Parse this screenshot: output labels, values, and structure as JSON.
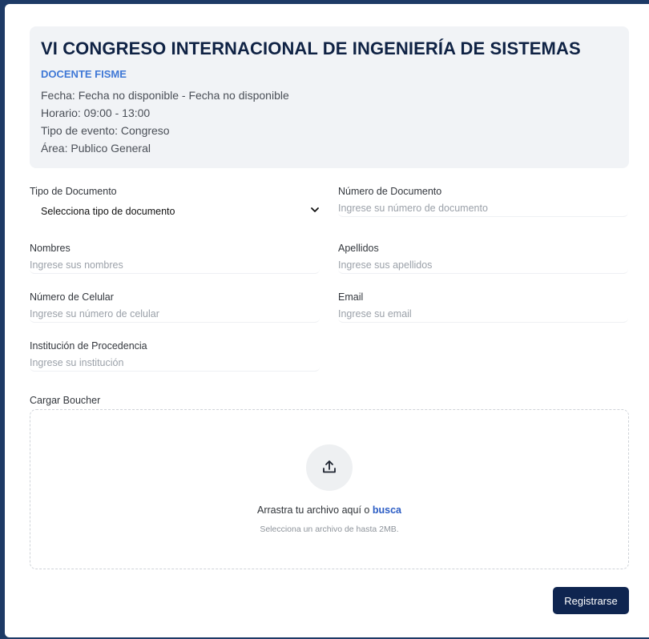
{
  "event": {
    "title": "VI CONGRESO INTERNACIONAL DE INGENIERÍA DE SISTEMAS",
    "subtitle": "DOCENTE FISME",
    "fecha": "Fecha: Fecha no disponible - Fecha no disponible",
    "horario": "Horario: 09:00 - 13:00",
    "tipo_evento": "Tipo de evento: Congreso",
    "area": "Área: Publico General"
  },
  "form": {
    "tipo_documento": {
      "label": "Tipo de Documento",
      "selected": "Selecciona tipo de documento"
    },
    "numero_documento": {
      "label": "Número de Documento",
      "placeholder": "Ingrese su número de documento",
      "value": ""
    },
    "nombres": {
      "label": "Nombres",
      "placeholder": "Ingrese sus nombres",
      "value": ""
    },
    "apellidos": {
      "label": "Apellidos",
      "placeholder": "Ingrese sus apellidos",
      "value": ""
    },
    "celular": {
      "label": "Número de Celular",
      "placeholder": "Ingrese su número de celular",
      "value": ""
    },
    "email": {
      "label": "Email",
      "placeholder": "Ingrese su email",
      "value": ""
    },
    "institucion": {
      "label": "Institución de Procedencia",
      "placeholder": "Ingrese su institución",
      "value": ""
    }
  },
  "upload": {
    "label": "Cargar Boucher",
    "drop_text": "Arrastra tu archivo aquí o",
    "browse_text": "busca",
    "hint": "Selecciona un archivo de hasta 2MB.",
    "icon": "upload-icon"
  },
  "submit_label": "Registrarse",
  "colors": {
    "page_background": "#1d3a66",
    "title": "#0f2244",
    "accent": "#3f78d6",
    "link": "#2b5cc4",
    "button": "#0f2550",
    "header_panel": "#f1f3f6"
  }
}
